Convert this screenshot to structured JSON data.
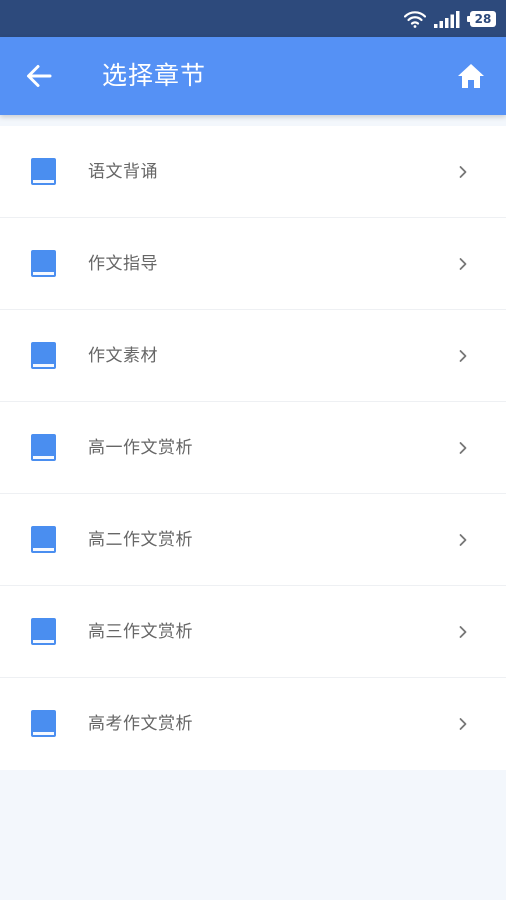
{
  "status_bar": {
    "battery_level": "28",
    "icons": [
      "wifi-icon",
      "signal-icon",
      "battery-icon"
    ]
  },
  "header": {
    "title": "选择章节",
    "back_icon": "arrow-left-icon",
    "home_icon": "home-icon"
  },
  "chapters": [
    {
      "label": "语文背诵"
    },
    {
      "label": "作文指导"
    },
    {
      "label": "作文素材"
    },
    {
      "label": "高一作文赏析"
    },
    {
      "label": "高二作文赏析"
    },
    {
      "label": "高三作文赏析"
    },
    {
      "label": "高考作文赏析"
    }
  ],
  "colors": {
    "status_bar": "#2d4a7c",
    "app_bar": "#5591f5",
    "book_icon": "#4a8ef0",
    "label_text": "#666666",
    "chevron": "#777777",
    "page_background": "#f3f7fc"
  }
}
